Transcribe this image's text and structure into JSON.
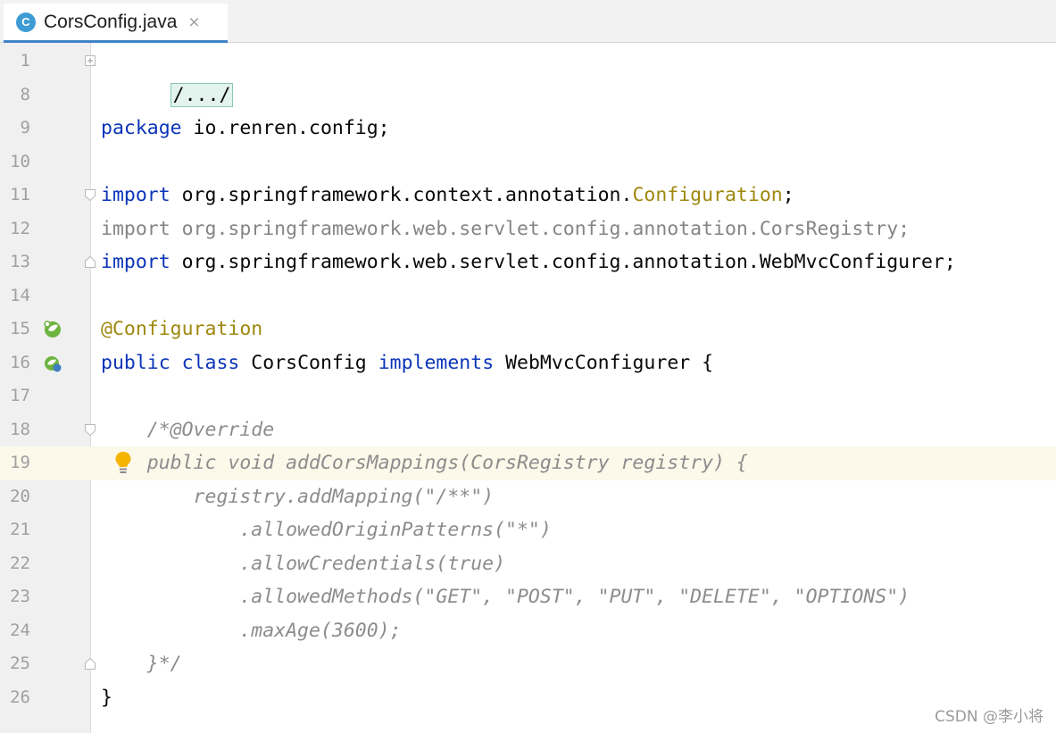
{
  "tab": {
    "icon_letter": "C",
    "title": "CorsConfig.java",
    "close_glyph": "×"
  },
  "lines": {
    "l1": {
      "num": "1",
      "code": "/.../"
    },
    "l8": {
      "num": "8",
      "code": ""
    },
    "l9": {
      "num": "9",
      "kw": "package",
      "rest": " io.renren.config;"
    },
    "l10": {
      "num": "10",
      "code": ""
    },
    "l11": {
      "num": "11",
      "kw": "import",
      "rest": " org.springframework.context.annotation.",
      "ann": "Configuration",
      "end": ";"
    },
    "l12": {
      "num": "12",
      "code": "import org.springframework.web.servlet.config.annotation.CorsRegistry;"
    },
    "l13": {
      "num": "13",
      "kw": "import",
      "rest": " org.springframework.web.servlet.config.annotation.WebMvcConfigurer;"
    },
    "l14": {
      "num": "14",
      "code": ""
    },
    "l15": {
      "num": "15",
      "ann": "@Configuration"
    },
    "l16": {
      "num": "16",
      "kw1": "public",
      "sp1": " ",
      "kw2": "class",
      "mid": " CorsConfig ",
      "kw3": "implements",
      "rest": " WebMvcConfigurer {"
    },
    "l17": {
      "num": "17",
      "code": ""
    },
    "l18": {
      "num": "18",
      "code": "    /*@Override"
    },
    "l19": {
      "num": "19",
      "code": "    public void addCorsMappings(CorsRegistry registry) {"
    },
    "l20": {
      "num": "20",
      "code": "        registry.addMapping(\"/**\")"
    },
    "l21": {
      "num": "21",
      "code": "            .allowedOriginPatterns(\"*\")"
    },
    "l22": {
      "num": "22",
      "code": "            .allowCredentials(true)"
    },
    "l23": {
      "num": "23",
      "code": "            .allowedMethods(\"GET\", \"POST\", \"PUT\", \"DELETE\", \"OPTIONS\")"
    },
    "l24": {
      "num": "24",
      "code": "            .maxAge(3600);"
    },
    "l25": {
      "num": "25",
      "code": "    }*/"
    },
    "l26": {
      "num": "26",
      "code": "}"
    }
  },
  "watermark": "CSDN @李小将",
  "colors": {
    "keyword": "#0b34b8",
    "annotation": "#9e880d",
    "comment": "#8c8c8c",
    "current_line": "#fcf8ea",
    "tab_underline": "#4083c9"
  },
  "icons": {
    "tab": "java-class-icon",
    "line15": "spring-bean-icon",
    "line16": "spring-config-icon",
    "line19": "intention-bulb-icon"
  }
}
